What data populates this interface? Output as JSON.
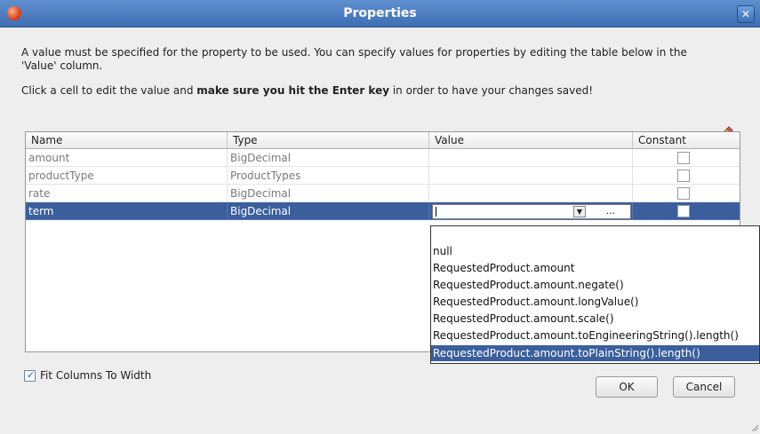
{
  "window": {
    "title": "Properties",
    "close_glyph": "✕"
  },
  "message": {
    "line1": "A value must be specified for the property to be used. You can specify values for properties by editing the table below in the",
    "line2": "'Value' column.",
    "line3_pre": "Click a cell to edit the value and ",
    "line3_bold": "make sure you hit the Enter key",
    "line3_post": " in order to have your changes saved!"
  },
  "icons": {
    "edit": "pencil-icon"
  },
  "table": {
    "columns": [
      "Name",
      "Type",
      "Value",
      "Constant"
    ],
    "rows": [
      {
        "name": "amount",
        "type": "BigDecimal",
        "value": "",
        "constant": false
      },
      {
        "name": "productType",
        "type": "ProductTypes",
        "value": "",
        "constant": false
      },
      {
        "name": "rate",
        "type": "BigDecimal",
        "value": "",
        "constant": false
      },
      {
        "name": "term",
        "type": "BigDecimal",
        "value": "",
        "constant": false,
        "selected": true
      }
    ],
    "editor_button": "..."
  },
  "dropdown": {
    "items": [
      "null",
      "RequestedProduct.amount",
      "RequestedProduct.amount.negate()",
      "RequestedProduct.amount.longValue()",
      "RequestedProduct.amount.scale()",
      "RequestedProduct.amount.toEngineeringString().length()",
      "RequestedProduct.amount.toPlainString().length()"
    ],
    "selected_index": 6
  },
  "options": {
    "fit_columns_label": "Fit Columns To Width",
    "fit_columns_checked": true
  },
  "buttons": {
    "ok": "OK",
    "cancel": "Cancel"
  },
  "colors": {
    "title_bar": "#4a7cc2",
    "selection": "#3b5f9c"
  }
}
